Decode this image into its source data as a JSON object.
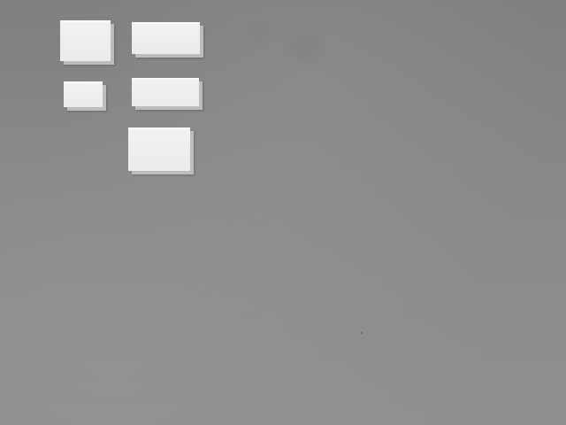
{
  "scene": {
    "background_color": "#868787",
    "block_color": "#efefef",
    "block_shadow_color": "#bdbdbd"
  },
  "blocks": [
    {
      "id": "block-1"
    },
    {
      "id": "block-2"
    },
    {
      "id": "block-3"
    },
    {
      "id": "block-4"
    },
    {
      "id": "block-5"
    }
  ]
}
